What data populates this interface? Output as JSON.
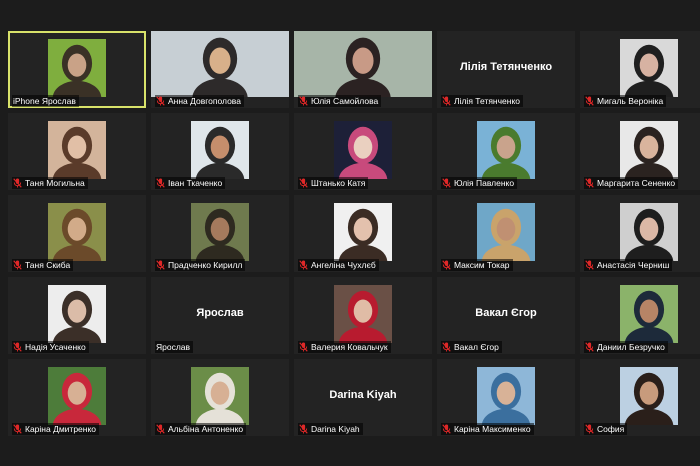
{
  "participants": [
    {
      "name": "iPhone Ярослав",
      "muted": false,
      "active": true,
      "layout": "thumb",
      "bg": "#7fae3e",
      "fg": "#3a3126",
      "skin": "#c9a287"
    },
    {
      "name": "Анна Довгополова",
      "muted": true,
      "layout": "full",
      "bg": "#c7cfd4",
      "fg": "#2d2a2a",
      "skin": "#d8b08a"
    },
    {
      "name": "Юлія Самойлова",
      "muted": true,
      "layout": "full",
      "bg": "#a7b5a8",
      "fg": "#2b2222",
      "skin": "#c89a86"
    },
    {
      "name": "Лілія Тетянченко",
      "muted": true,
      "layout": "name",
      "display_name": "Лілія Тетянченко"
    },
    {
      "name": "Мигаль Вероніка",
      "muted": true,
      "layout": "thumb",
      "bg": "#d9d9d9",
      "fg": "#1f1f1f",
      "skin": "#d7b2a2"
    },
    {
      "name": "Таня Могильна",
      "muted": true,
      "layout": "thumb",
      "bg": "#d3b49b",
      "fg": "#5a3b2a",
      "skin": "#e1bfa6"
    },
    {
      "name": "Іван Ткаченко",
      "muted": true,
      "layout": "thumb",
      "bg": "#dfe6ea",
      "fg": "#2a2a2a",
      "skin": "#c58e6c"
    },
    {
      "name": "Штанько Катя",
      "muted": true,
      "layout": "thumb",
      "bg": "#1d2038",
      "fg": "#c84a7c",
      "skin": "#ead0c0"
    },
    {
      "name": "Юлія Павленко",
      "muted": true,
      "layout": "thumb",
      "bg": "#7ab2d6",
      "fg": "#4a7b2e",
      "skin": "#c9a38c"
    },
    {
      "name": "Маргарита Сененко",
      "muted": true,
      "layout": "thumb",
      "bg": "#e8e8e8",
      "fg": "#2b2320",
      "skin": "#d9b49d"
    },
    {
      "name": "Таня Скиба",
      "muted": true,
      "layout": "thumb",
      "bg": "#8a8f4a",
      "fg": "#6b4a2a",
      "skin": "#d2ab89"
    },
    {
      "name": "Прадченко Кирилл",
      "muted": true,
      "layout": "thumb",
      "bg": "#6f7a4e",
      "fg": "#2e2a20",
      "skin": "#a57a5d"
    },
    {
      "name": "Ангеліна Чухлєб",
      "muted": true,
      "layout": "thumb",
      "bg": "#f0f0f0",
      "fg": "#3b2c24",
      "skin": "#e3c1ad"
    },
    {
      "name": "Максим Токар",
      "muted": true,
      "layout": "thumb",
      "bg": "#6fa7c8",
      "fg": "#c9a36b",
      "skin": "#c09072"
    },
    {
      "name": "Анастасія Черниш",
      "muted": true,
      "layout": "thumb",
      "bg": "#cfcfcf",
      "fg": "#1e1e1e",
      "skin": "#dcb8a6"
    },
    {
      "name": "Надія Усаченко",
      "muted": true,
      "layout": "thumb",
      "bg": "#ededed",
      "fg": "#3b2f28",
      "skin": "#dbbca8"
    },
    {
      "name": "Ярослав",
      "muted": false,
      "layout": "name",
      "display_name": "Ярослав"
    },
    {
      "name": "Валерия Ковальчук",
      "muted": true,
      "layout": "thumb",
      "bg": "#6a5046",
      "fg": "#b81b2f",
      "skin": "#e0bca6"
    },
    {
      "name": "Вакал Єгор",
      "muted": true,
      "layout": "name",
      "display_name": "Вакал Єгор"
    },
    {
      "name": "Даниил Безручко",
      "muted": true,
      "layout": "thumb",
      "bg": "#8bb36a",
      "fg": "#1d2a3a",
      "skin": "#b78466"
    },
    {
      "name": "Каріна Дмитренко",
      "muted": true,
      "layout": "thumb",
      "bg": "#4d7c3a",
      "fg": "#c8283b",
      "skin": "#d7b094"
    },
    {
      "name": "Альбіна Антоненко",
      "muted": true,
      "layout": "thumb",
      "bg": "#6b8d48",
      "fg": "#e5e1d8",
      "skin": "#d7b094"
    },
    {
      "name": "Darina Kiyah",
      "muted": true,
      "layout": "name",
      "display_name": "Darina Kiyah"
    },
    {
      "name": "Каріна Максименко",
      "muted": true,
      "layout": "thumb",
      "bg": "#8eb7d8",
      "fg": "#3b6f9e",
      "skin": "#d8b297"
    },
    {
      "name": "София",
      "muted": true,
      "layout": "thumb",
      "bg": "#bcd0e2",
      "fg": "#2a1f1a",
      "skin": "#c89b7c"
    }
  ],
  "colors": {
    "background": "#1c1c1c",
    "tile": "#232323",
    "active_border": "#d8e26a",
    "mute_icon": "#e02828",
    "text": "#ffffff"
  }
}
